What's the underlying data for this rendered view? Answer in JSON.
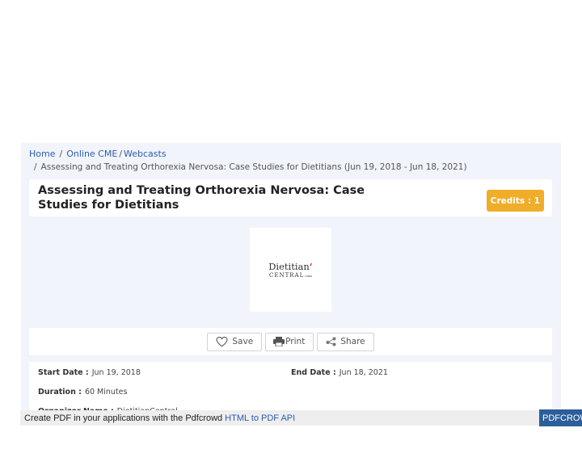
{
  "breadcrumb": {
    "home": "Home",
    "sep1": "/",
    "online_cme": "Online CME",
    "sep2": "/",
    "webcasts": "Webcasts",
    "sep3": "/",
    "current": "Assessing and Treating Orthorexia Nervosa: Case Studies for Dietitians (Jun 19, 2018 - Jun 18, 2021)"
  },
  "course": {
    "title": "Assessing and Treating Orthorexia Nervosa: Case Studies for Dietitians",
    "credits": "Credits : 1"
  },
  "logo": {
    "top": "Dietitian",
    "bottom": "CENTRAL",
    "suffix": ".com",
    "icon": "pepper-icon"
  },
  "actions": {
    "save": "Save",
    "print": "Print",
    "share": "Share"
  },
  "details": {
    "start_label": "Start Date :",
    "start_value": "Jun 19, 2018",
    "end_label": "End Date :",
    "end_value": "Jun 18, 2021",
    "duration_label": "Duration :",
    "duration_value": "60 Minutes",
    "organizer_label": "Organizer Name :",
    "organizer_value": "DietitianCentral"
  },
  "pdf_footer": {
    "text": "Create PDF in your applications with the Pdfcrowd",
    "link": "HTML to PDF API",
    "brand": "PDFCROWD"
  },
  "colors": {
    "accent_link": "#2a5db0",
    "credits_badge": "#f0ad2a",
    "panel_bg": "#f2f4fb"
  }
}
